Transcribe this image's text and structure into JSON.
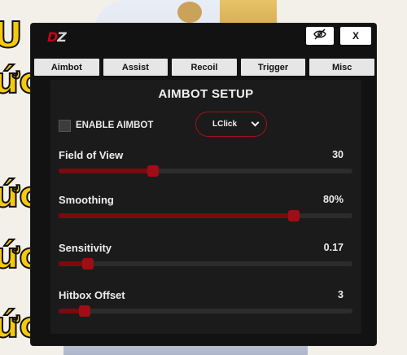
{
  "background": {
    "glyphs": [
      "U",
      "ức",
      "ức",
      "ức",
      "ức"
    ]
  },
  "window": {
    "logo_d": "D",
    "logo_z": "Z",
    "hide_icon": "eye-off-icon",
    "close_label": "X"
  },
  "tabs": [
    "Aimbot",
    "Assist",
    "Recoil",
    "Trigger",
    "Misc"
  ],
  "content": {
    "heading": "AIMBOT SETUP",
    "enable_label": "ENABLE AIMBOT",
    "enable_checked": false,
    "key_select_value": "LClick"
  },
  "sliders": [
    {
      "label": "Field of View",
      "value_text": "30",
      "fraction": 0.32
    },
    {
      "label": "Smoothing",
      "value_text": "80%",
      "fraction": 0.8
    },
    {
      "label": "Sensitivity",
      "value_text": "0.17",
      "fraction": 0.1
    },
    {
      "label": "Hitbox Offset",
      "value_text": "3",
      "fraction": 0.09
    }
  ],
  "colors": {
    "accent": "#a10d14",
    "fill": "#7a0a10",
    "panel": "#121212",
    "content": "#1b1b1b"
  }
}
